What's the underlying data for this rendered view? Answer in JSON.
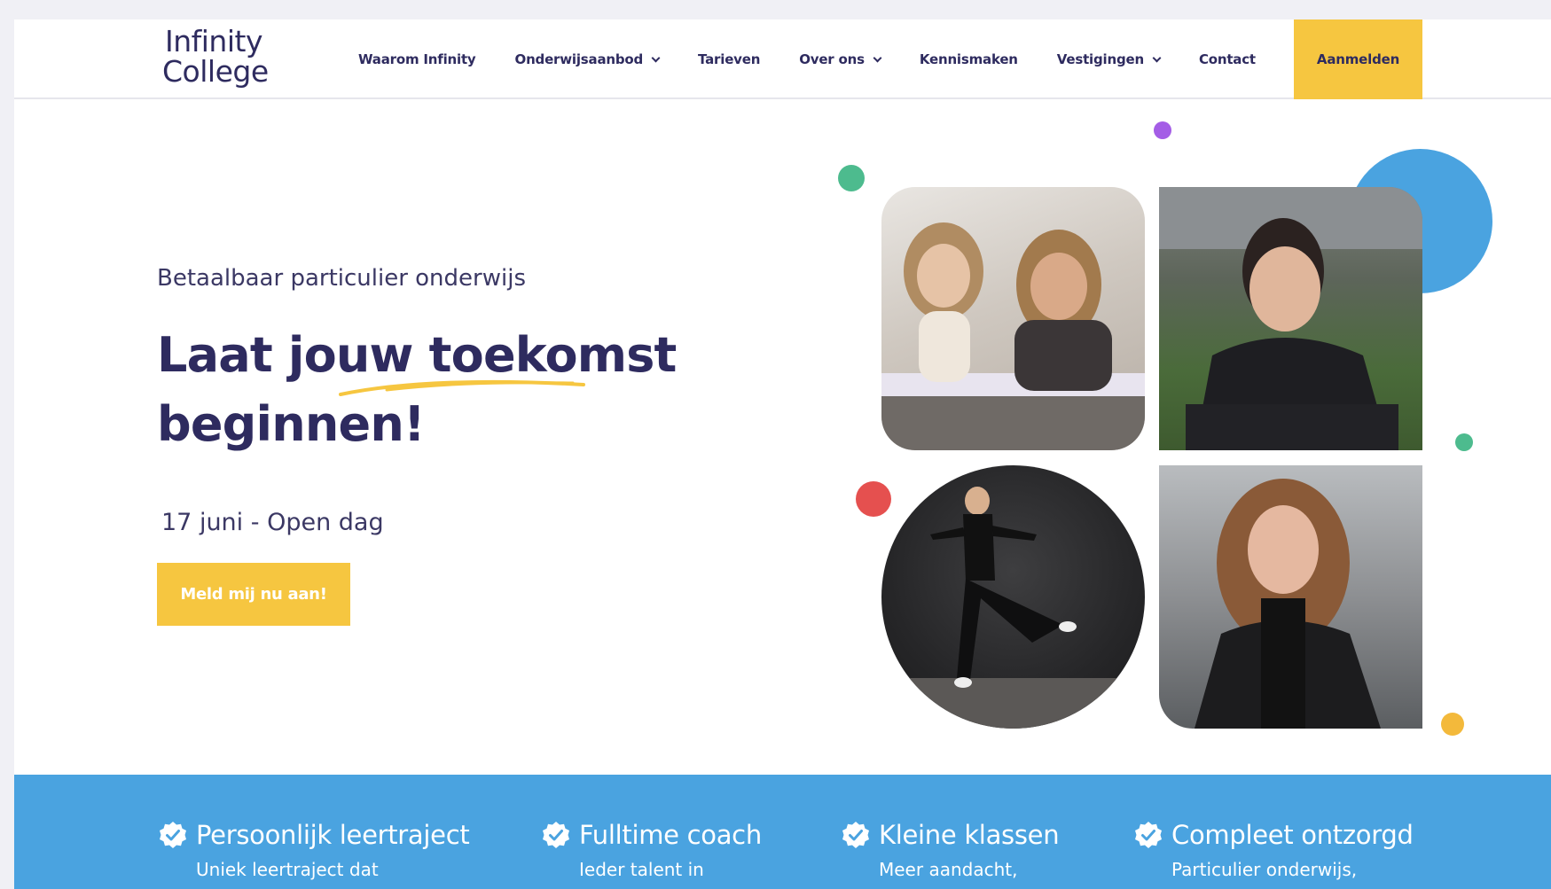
{
  "logo": {
    "line1": "Infinity",
    "line2": "College"
  },
  "nav": {
    "items": [
      {
        "label": "Waarom Infinity",
        "dropdown": false
      },
      {
        "label": "Onderwijsaanbod",
        "dropdown": true
      },
      {
        "label": "Tarieven",
        "dropdown": false
      },
      {
        "label": "Over ons",
        "dropdown": true
      },
      {
        "label": "Kennismaken",
        "dropdown": false
      },
      {
        "label": "Vestigingen",
        "dropdown": true
      },
      {
        "label": "Contact",
        "dropdown": false
      }
    ],
    "cta_label": "Aanmelden"
  },
  "hero": {
    "eyebrow": "Betaalbaar particulier onderwijs",
    "headline_line1": "Laat jouw toekomst",
    "headline_line2": "beginnen!",
    "event": "17 juni - Open dag",
    "cta_label": "Meld mij nu aan!"
  },
  "benefits": [
    {
      "title": "Persoonlijk leertraject",
      "desc": "Uniek leertraject dat"
    },
    {
      "title": "Fulltime coach",
      "desc": "Ieder talent in"
    },
    {
      "title": "Kleine klassen",
      "desc": "Meer aandacht,"
    },
    {
      "title": "Compleet ontzorgd",
      "desc": "Particulier onderwijs,"
    }
  ],
  "colors": {
    "brand": "#2e2b5f",
    "accent": "#f6c640",
    "band": "#4aa3e0",
    "dot_green": "#4dbb8e",
    "dot_purple": "#a45de6",
    "dot_red": "#e5504f",
    "dot_yellow": "#f3b93b",
    "dot_blue": "#4aa3e0"
  }
}
